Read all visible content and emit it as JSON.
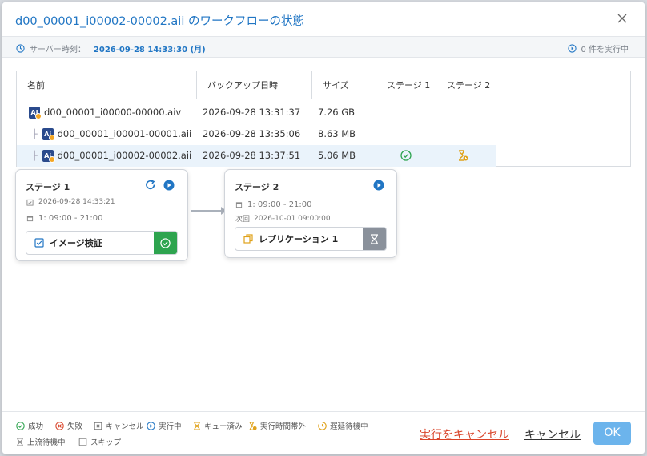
{
  "dialog": {
    "title": "d00_00001_i00002-00002.aii のワークフローの状態",
    "server_time_label": "サーバー時刻：",
    "server_time_value": "2026-09-28 14:33:30 (月)",
    "running_text": "0 件を実行中"
  },
  "table": {
    "headers": [
      "名前",
      "バックアップ日時",
      "サイズ",
      "ステージ 1",
      "ステージ 2"
    ],
    "rows": [
      {
        "name": "d00_00001_i00000-00000.aiv",
        "datetime": "2026-09-28 13:31:37",
        "size": "7.26 GB",
        "stage1": "",
        "stage2": "",
        "tree": ""
      },
      {
        "name": "d00_00001_i00001-00001.aii",
        "datetime": "2026-09-28 13:35:06",
        "size": "8.63 MB",
        "stage1": "",
        "stage2": "",
        "tree": "├"
      },
      {
        "name": "d00_00001_i00002-00002.aii",
        "datetime": "2026-09-28 13:37:51",
        "size": "5.06 MB",
        "stage1": "success-icon",
        "stage2": "outside-exec-time-icon",
        "tree": "├"
      }
    ]
  },
  "stage1": {
    "title": "ステージ 1",
    "last_run": "2026-09-28 14:33:21",
    "schedule": "1: 09:00 - 21:00",
    "task_label": "イメージ検証",
    "task_status": "success"
  },
  "stage2": {
    "title": "ステージ 2",
    "schedule": "1: 09:00 - 21:00",
    "next_run_label": "次回",
    "next_run": "2026-10-01 09:00:00",
    "task_label": "レプリケーション 1",
    "task_status": "queued"
  },
  "legend": {
    "success": "成功",
    "failed": "失敗",
    "cancelled": "キャンセル",
    "running": "実行中",
    "queued": "キュー済み",
    "outside_time": "実行時間帯外",
    "delayed": "遅延待機中",
    "upstream": "上流待機中",
    "skip": "スキップ"
  },
  "buttons": {
    "cancel_execution": "実行をキャンセル",
    "cancel": "キャンセル",
    "ok": "OK"
  },
  "colors": {
    "accent": "#2176c4",
    "success": "#2ea44f",
    "error": "#d9452b",
    "warning": "#e0a21a",
    "ok_button": "#6cb4ec"
  }
}
